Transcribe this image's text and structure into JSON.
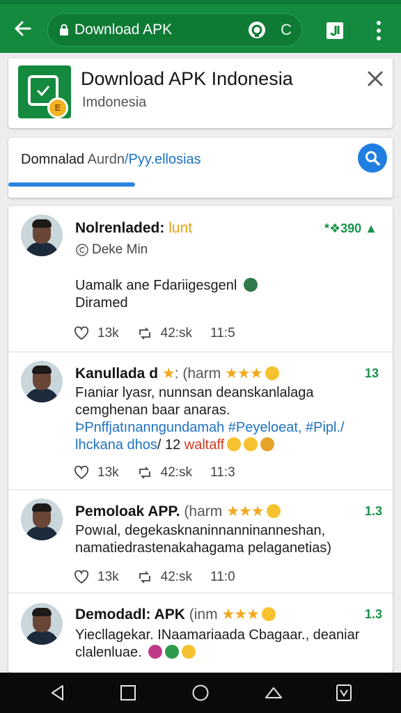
{
  "toolbar": {
    "url_text": "Download APK",
    "reload_label": "C"
  },
  "app_card": {
    "title": "Download APK  Indonesia",
    "subtitle": "Imdonesia",
    "badge_glyph": "E"
  },
  "search": {
    "query_part1": "Domnalad",
    "query_part2": "Aurdn",
    "query_part3": "/Pyy.ellosias",
    "progress": 0.33
  },
  "posts": [
    {
      "name": "Nolrenladed:",
      "tag": "lunt",
      "count": "*❖390 ▲",
      "handle": "Deke Min",
      "body": "Uamalk ane Fdariigesgenl",
      "body2": "Diramed",
      "likes": "13k",
      "shares": "42:sk",
      "time": "11:5"
    },
    {
      "name": "Kanullada d",
      "rest": ": (harm",
      "stars": "★★★",
      "count": "13",
      "body": "Fıaniar lyasr, nunnsan deanskanlalaga cemghenan baar anaras.",
      "link": "ÞPnffjatınanngundamah #Peyeloeat, #Pipl./ lhckana dhos",
      "link_tail": "/ 12",
      "hl": "waltaff",
      "likes": "13k",
      "shares": "42:sk",
      "time": "11:3"
    },
    {
      "name": "Pemoloak APP.",
      "rest": "(harm",
      "stars": "★★★",
      "count": "1.3",
      "body": "Powıal, degekasknaninnanninanneshan, namatiedrastenakahagama pelaganetias)",
      "likes": "13k",
      "shares": "42:sk",
      "time": "11:0"
    },
    {
      "name": "Demodadl: APK",
      "rest": "(inm",
      "stars": "★★★",
      "count": "1.3",
      "body": "Yiecllagekar. INaamariaada Cbagaar., deaniar clalenluae."
    }
  ],
  "colors": {
    "appbar": "#138a3e",
    "accent_blue": "#1f7fe0",
    "count_green": "#17934a",
    "star": "#f2a81d"
  },
  "icons": [
    "back-arrow-icon",
    "lock-icon",
    "eye-icon",
    "extension-icon",
    "overflow-menu-icon",
    "close-icon",
    "search-icon",
    "heart-icon",
    "repost-icon",
    "nav-back-icon",
    "nav-recents-icon",
    "nav-home-icon",
    "nav-up-icon",
    "nav-screenshot-icon"
  ]
}
